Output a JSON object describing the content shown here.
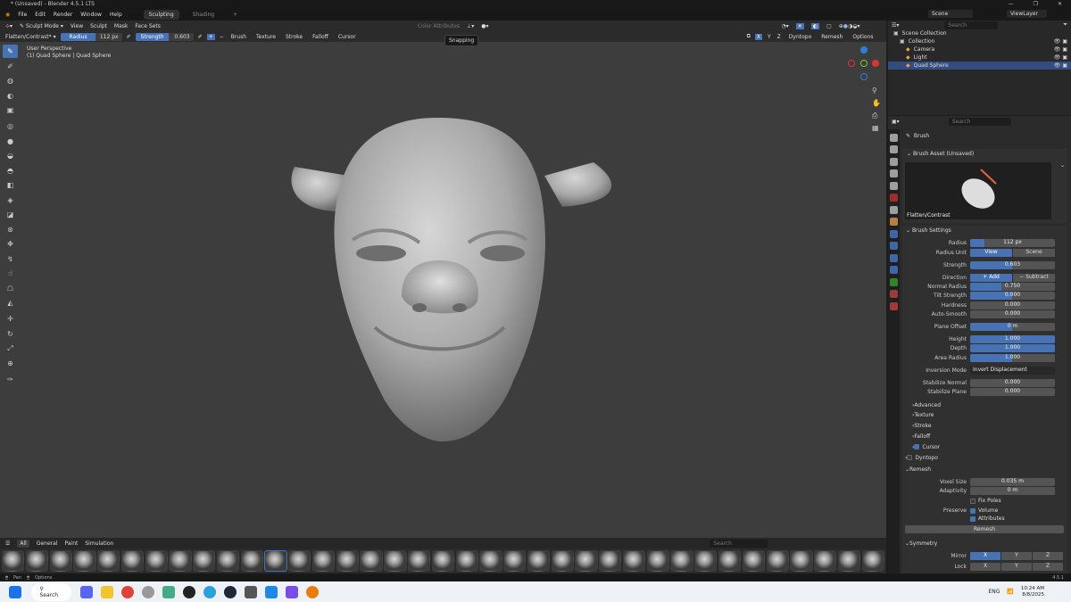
{
  "window": {
    "title": "* (Unsaved) - Blender 4.5.1 LTS",
    "minimize": "—",
    "maximize": "❐",
    "close": "✕"
  },
  "menu": [
    "File",
    "Edit",
    "Render",
    "Window",
    "Help"
  ],
  "workspaces": [
    {
      "label": "Sculpting",
      "active": true
    },
    {
      "label": "Shading",
      "active": false
    },
    {
      "label": "+",
      "active": false
    }
  ],
  "header": {
    "mode": "Sculpt Mode",
    "items": [
      "View",
      "Sculpt",
      "Mask",
      "Face Sets"
    ],
    "color_attributes": "Color Attributes"
  },
  "toolheader": {
    "brush": "Flatten/Contrast*",
    "radius_label": "Radius",
    "radius_value": "112 px",
    "strength_label": "Strength",
    "strength_value": "0.603",
    "menus": [
      "Brush",
      "Texture",
      "Stroke",
      "Falloff",
      "Cursor"
    ],
    "axes": [
      "X",
      "Y",
      "Z"
    ],
    "right_menus": [
      "Dyntopo",
      "Remesh",
      "Options"
    ]
  },
  "tooltip": "Snapping",
  "viewport": {
    "perspective": "User Perspective",
    "object": "(1) Quad Sphere | Quad Sphere"
  },
  "toolbar": [
    "draw",
    "draw-sharp",
    "clay",
    "clay-strips",
    "layer",
    "inflate",
    "blob",
    "crease",
    "smooth",
    "flatten",
    "fill",
    "scrape",
    "pinch",
    "grab",
    "snake-hook",
    "thumb",
    "pose",
    "mask",
    "move",
    "rotate",
    "scale",
    "transform",
    "annotate"
  ],
  "shelf": {
    "tabs": [
      "All",
      "General",
      "Paint",
      "Simulation"
    ],
    "active_tab": "All",
    "search_placeholder": "Search",
    "brush_count": 37,
    "active_index": 11
  },
  "status": {
    "pan": "Pan",
    "options": "Options",
    "version": "4.5.1"
  },
  "taskbar": {
    "search": "Search",
    "lang": "ENG",
    "time": "10:24 AM",
    "date": "8/8/2025"
  },
  "scene": {
    "scene": "Scene",
    "view_layer": "ViewLayer",
    "search_placeholder": "Search"
  },
  "outliner": [
    {
      "label": "Scene Collection",
      "indent": 0
    },
    {
      "label": "Collection",
      "indent": 1
    },
    {
      "label": "Camera",
      "indent": 2
    },
    {
      "label": "Light",
      "indent": 2
    },
    {
      "label": "Quad Sphere",
      "indent": 2,
      "selected": true
    }
  ],
  "properties": {
    "search_placeholder": "Search",
    "context": "Brush",
    "asset_section": "Brush Asset (Unsaved)",
    "asset_name": "Flatten/Contrast",
    "settings_section": "Brush Settings",
    "rows": [
      {
        "label": "Radius",
        "value": "112 px",
        "fill": 0.17
      },
      {
        "label": "Radius Unit",
        "seg": [
          "View",
          "Scene"
        ],
        "on": 0
      },
      {
        "label": "Strength",
        "value": "0.603",
        "fill": 0.49
      },
      {
        "label": "Direction",
        "seg": [
          "+   Add",
          "−   Subtract"
        ],
        "on": 0
      },
      {
        "label": "Normal Radius",
        "value": "0.750",
        "fill": 0.37
      },
      {
        "label": "Tilt Strength",
        "value": "0.000",
        "fill": 0.49
      },
      {
        "label": "Hardness",
        "value": "0.000",
        "fill": 0
      },
      {
        "label": "Auto-Smooth",
        "value": "0.000",
        "fill": 0
      },
      {
        "label": "Plane Offset",
        "value": "0 m",
        "fill": 0.49
      },
      {
        "label": "Height",
        "value": "1.000",
        "fill": 1
      },
      {
        "label": "Depth",
        "value": "1.000",
        "fill": 1
      },
      {
        "label": "Area Radius",
        "value": "1.000",
        "fill": 0.49
      },
      {
        "label": "Inversion Mode",
        "value": "Invert Displacement",
        "select": true
      },
      {
        "label": "Stabilize Normal",
        "value": "0.000",
        "fill": 0
      },
      {
        "label": "Stabilize Plane",
        "value": "0.000",
        "fill": 0
      }
    ],
    "subsections": [
      "Advanced",
      "Texture",
      "Stroke",
      "Falloff",
      "Cursor"
    ],
    "dyntopo": "Dyntopo",
    "remesh": "Remesh",
    "voxel_label": "Voxel Size",
    "voxel": "0.035 m",
    "adapt_label": "Adaptivity",
    "adapt": "0 m",
    "fix_poles": "Fix Poles",
    "preserve": "Preserve",
    "volume": "Volume",
    "attributes": "Attributes",
    "remesh_button": "Remesh",
    "symmetry": "Symmetry",
    "mirror": "Mirror",
    "lock": "Lock",
    "axes": [
      "X",
      "Y",
      "Z"
    ]
  }
}
